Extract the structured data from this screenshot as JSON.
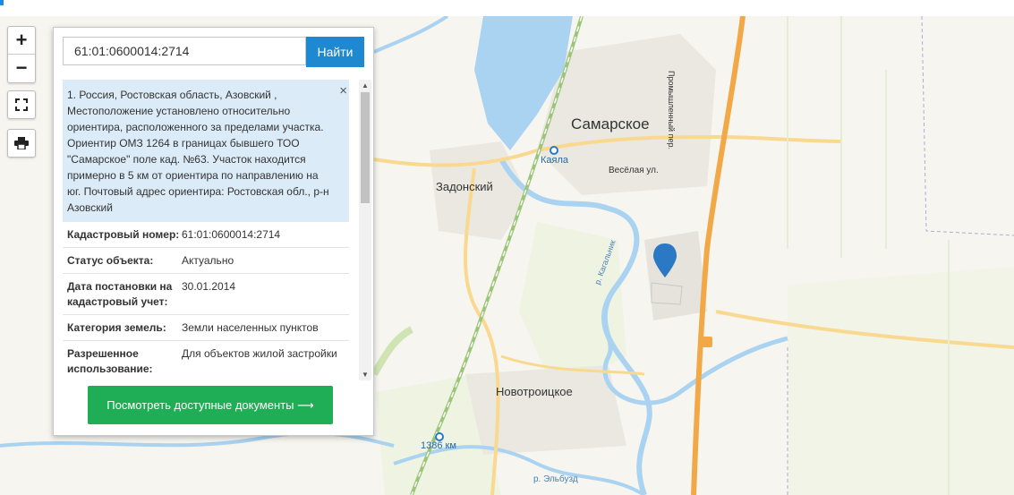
{
  "search": {
    "value": "61:01:0600014:2714",
    "button_label": "Найти"
  },
  "controls": {
    "zoom_in": "+",
    "zoom_out": "−"
  },
  "info": {
    "address": "1. Россия, Ростовская область, Азовский , Местоположение установлено относительно ориентира, расположенного за пределами участка. Ориентир ОМЗ 1264 в границах бывшего ТОО \"Самарское\" поле кад. №63. Участок находится примерно в 5 км от ориентира по направлению на юг. Почтовый адрес ориентира: Ростовская обл., р-н Азовский",
    "close_label": "×",
    "rows": [
      {
        "key": "Кадастровый номер:",
        "value": "61:01:0600014:2714"
      },
      {
        "key": "Статус объекта:",
        "value": "Актуально"
      },
      {
        "key": "Дата постановки на кадастровый учет:",
        "value": "30.01.2014"
      },
      {
        "key": "Категория земель:",
        "value": "Земли населенных пунктов"
      },
      {
        "key": "Разрешенное использование:",
        "value": "Для объектов жилой застройки"
      }
    ],
    "docs_button": "Посмотреть доступные документы ⟶"
  },
  "map_labels": {
    "samarskoe": "Самарское",
    "zadonsky": "Задонский",
    "kayala": "Каяла",
    "veselaya": "Весёлая ул.",
    "promyshlenny": "Промышленный пер.",
    "kagalnik": "р. Кагальник",
    "novotroitskoe": "Новотроицкое",
    "km1386": "1386 км",
    "elbuzd": "р. Эльбузд"
  },
  "colors": {
    "accent": "#1e88d0",
    "docs_button": "#1fae56",
    "marker": "#2b78c5",
    "river": "#a9d3f0"
  }
}
